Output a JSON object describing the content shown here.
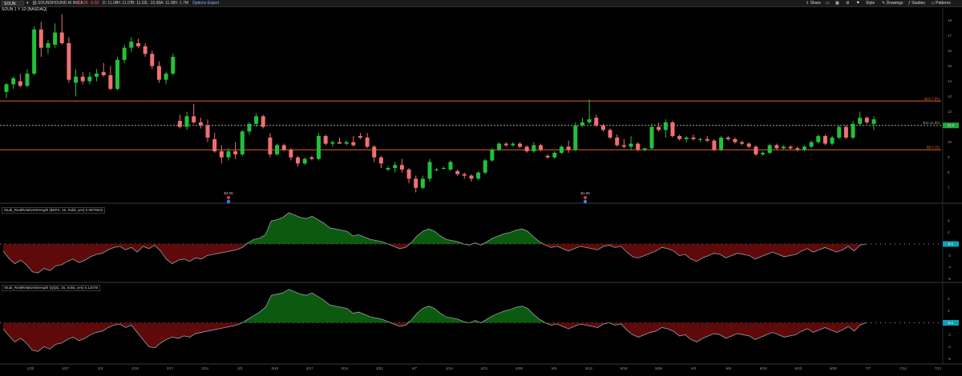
{
  "topbar": {
    "symbol": "SOUN",
    "quote": "SOUNDHOUND AI INC A",
    "price": "$1.28",
    "change": "-0.02",
    "stats": [
      "D: 11.06",
      "H: 11.07",
      "B: 11.02",
      "L: 10.98",
      "A: 11.08",
      "V: 1.7M"
    ],
    "link": "Options Expert",
    "buttons": [
      "Share",
      "Style",
      "Drawings",
      "Studies",
      "Patterns"
    ]
  },
  "chart_header": "SOUN 1 Y 1D [NASDAQ]",
  "price_levels": {
    "upper": {
      "label": "$12.7 (R)",
      "color": "#e0602b"
    },
    "current": {
      "label": "$11.11 (D)",
      "color": "#cccccc"
    },
    "lower": {
      "label": "$9.5 (S)",
      "color": "#e0602b"
    },
    "last_badge": "11.1"
  },
  "event_markers": [
    {
      "label": "$3.25",
      "x_date": "2/28"
    },
    {
      "label": "$1.09",
      "x_date": "5/8"
    }
  ],
  "study1_label": "Studi_RealRelativeStrength ($SPX, 15, Solid, yes)  0.0979523",
  "study2_label": "Studi_RealRelativeStrength (QQQ, 15, Solid, yes)  0.12078",
  "study_badge": "0.1",
  "colors": {
    "up": "#23c03a",
    "down": "#f07070",
    "pos_fill": "#0c5a10",
    "neg_fill": "#5e0a0a",
    "level": "#e0602b"
  },
  "chart_data": {
    "type": "candlestick",
    "price_axis": {
      "ylim": [
        6.2,
        18.6
      ],
      "ticks": [
        7,
        8,
        9,
        10,
        11,
        12,
        13,
        14,
        15,
        16,
        17,
        18
      ]
    },
    "x_ticks": [
      "1/20",
      "1/27",
      "2/3",
      "2/10",
      "2/17",
      "2/24",
      "3/3",
      "3/10",
      "3/17",
      "3/24",
      "3/31",
      "4/7",
      "4/14",
      "4/21",
      "4/28",
      "5/5",
      "5/12",
      "5/19",
      "5/26",
      "6/2",
      "6/9",
      "6/16",
      "6/23",
      "6/30",
      "7/7",
      "7/14",
      "7/21"
    ],
    "candles": [
      [
        13.3,
        13.9,
        12.9,
        13.8
      ],
      [
        13.8,
        14.3,
        13.5,
        14.2
      ],
      [
        14.0,
        14.5,
        13.6,
        13.7
      ],
      [
        13.7,
        14.8,
        13.6,
        14.5
      ],
      [
        14.5,
        17.6,
        14.4,
        17.4
      ],
      [
        17.4,
        17.9,
        15.6,
        16.2
      ],
      [
        16.2,
        16.7,
        15.8,
        16.5
      ],
      [
        16.4,
        17.8,
        16.2,
        17.2
      ],
      [
        17.2,
        18.4,
        16.4,
        16.5
      ],
      [
        16.5,
        16.9,
        13.9,
        14.1
      ],
      [
        13.9,
        14.8,
        13.0,
        14.3
      ],
      [
        14.3,
        14.6,
        13.8,
        14.0
      ],
      [
        14.0,
        14.6,
        13.8,
        14.3
      ],
      [
        14.3,
        14.8,
        14.0,
        14.5
      ],
      [
        14.6,
        15.2,
        14.3,
        14.4
      ],
      [
        14.4,
        15.0,
        13.4,
        13.5
      ],
      [
        13.5,
        15.6,
        13.4,
        15.4
      ],
      [
        15.4,
        16.4,
        15.2,
        16.2
      ],
      [
        16.2,
        16.9,
        15.9,
        16.6
      ],
      [
        16.5,
        16.8,
        16.2,
        16.3
      ],
      [
        16.3,
        16.5,
        15.6,
        15.8
      ],
      [
        15.8,
        16.0,
        14.8,
        15.0
      ],
      [
        15.0,
        15.3,
        13.9,
        14.1
      ],
      [
        14.1,
        14.6,
        13.8,
        14.5
      ],
      [
        14.5,
        15.8,
        14.4,
        15.6
      ],
      [
        11.4,
        11.8,
        10.9,
        11.0
      ],
      [
        11.0,
        12.0,
        10.8,
        11.7
      ],
      [
        11.7,
        12.5,
        11.2,
        11.3
      ],
      [
        11.3,
        11.6,
        10.9,
        11.1
      ],
      [
        11.1,
        11.5,
        10.0,
        10.3
      ],
      [
        10.2,
        10.6,
        9.3,
        9.4
      ],
      [
        9.4,
        9.8,
        8.6,
        9.0
      ],
      [
        9.0,
        9.6,
        8.8,
        9.4
      ],
      [
        9.4,
        10.0,
        8.9,
        9.2
      ],
      [
        9.2,
        10.8,
        9.1,
        10.7
      ],
      [
        10.7,
        11.3,
        10.5,
        11.2
      ],
      [
        11.2,
        11.9,
        11.0,
        11.7
      ],
      [
        11.7,
        11.8,
        10.9,
        11.0
      ],
      [
        10.3,
        10.6,
        9.0,
        9.2
      ],
      [
        9.2,
        9.9,
        9.1,
        9.8
      ],
      [
        9.8,
        9.9,
        9.4,
        9.5
      ],
      [
        9.5,
        9.6,
        8.8,
        9.0
      ],
      [
        9.0,
        9.1,
        8.4,
        8.6
      ],
      [
        8.6,
        9.0,
        8.5,
        8.9
      ],
      [
        9.0,
        9.1,
        8.8,
        8.9
      ],
      [
        8.9,
        10.6,
        8.8,
        10.4
      ],
      [
        10.4,
        10.5,
        9.8,
        9.9
      ],
      [
        9.9,
        10.1,
        9.7,
        10.0
      ],
      [
        10.0,
        10.3,
        9.9,
        9.9
      ],
      [
        9.9,
        10.1,
        9.8,
        10.0
      ],
      [
        10.0,
        10.4,
        9.7,
        9.8
      ],
      [
        10.4,
        10.6,
        10.2,
        10.3
      ],
      [
        10.3,
        10.6,
        9.6,
        9.7
      ],
      [
        9.7,
        9.8,
        8.7,
        9.0
      ],
      [
        9.0,
        9.1,
        8.3,
        8.6
      ],
      [
        8.2,
        8.4,
        8.1,
        8.3
      ],
      [
        8.3,
        8.7,
        8.0,
        8.5
      ],
      [
        8.5,
        8.9,
        8.0,
        8.2
      ],
      [
        8.2,
        8.3,
        7.3,
        7.6
      ],
      [
        7.6,
        7.8,
        6.7,
        7.0
      ],
      [
        7.0,
        7.8,
        6.9,
        7.6
      ],
      [
        7.6,
        8.9,
        7.4,
        8.7
      ],
      [
        8.2,
        8.3,
        8.1,
        8.2
      ],
      [
        8.3,
        8.4,
        8.2,
        8.3
      ],
      [
        8.2,
        8.8,
        8.1,
        8.7
      ],
      [
        8.1,
        8.2,
        7.8,
        7.9
      ],
      [
        7.9,
        8.0,
        7.6,
        7.8
      ],
      [
        7.8,
        7.9,
        7.4,
        7.6
      ],
      [
        7.6,
        8.1,
        7.5,
        8.0
      ],
      [
        8.0,
        8.9,
        7.9,
        8.8
      ],
      [
        8.8,
        9.6,
        8.7,
        9.5
      ],
      [
        9.5,
        10.0,
        9.4,
        9.9
      ],
      [
        9.9,
        10.0,
        9.7,
        9.8
      ],
      [
        9.8,
        10.0,
        9.7,
        9.9
      ],
      [
        9.9,
        10.0,
        9.6,
        9.7
      ],
      [
        9.7,
        9.8,
        9.3,
        9.4
      ],
      [
        9.4,
        10.0,
        9.3,
        9.8
      ],
      [
        9.8,
        9.9,
        9.4,
        9.5
      ],
      [
        9.1,
        9.2,
        8.9,
        9.0
      ],
      [
        9.0,
        9.4,
        8.9,
        9.3
      ],
      [
        9.3,
        9.8,
        9.2,
        9.7
      ],
      [
        9.7,
        10.1,
        9.3,
        9.5
      ],
      [
        9.5,
        11.3,
        9.4,
        11.1
      ],
      [
        11.1,
        11.6,
        11.0,
        11.3
      ],
      [
        11.3,
        12.8,
        11.2,
        11.5
      ],
      [
        11.6,
        11.8,
        11.0,
        11.1
      ],
      [
        11.1,
        11.2,
        10.7,
        10.8
      ],
      [
        10.8,
        10.9,
        10.2,
        10.3
      ],
      [
        10.3,
        10.5,
        9.7,
        9.8
      ],
      [
        9.8,
        10.2,
        9.6,
        9.7
      ],
      [
        9.7,
        10.4,
        9.5,
        9.9
      ],
      [
        9.9,
        10.0,
        9.4,
        9.5
      ],
      [
        9.5,
        9.6,
        9.4,
        9.6
      ],
      [
        9.6,
        11.2,
        9.5,
        11.0
      ],
      [
        11.0,
        11.3,
        10.7,
        10.8
      ],
      [
        10.8,
        11.5,
        10.3,
        11.3
      ],
      [
        11.3,
        11.4,
        10.3,
        10.4
      ],
      [
        10.4,
        10.5,
        10.1,
        10.2
      ],
      [
        10.2,
        10.4,
        10.0,
        10.3
      ],
      [
        10.3,
        10.5,
        10.1,
        10.2
      ],
      [
        10.2,
        10.3,
        10.0,
        10.2
      ],
      [
        10.2,
        10.4,
        10.0,
        10.1
      ],
      [
        10.1,
        10.2,
        9.4,
        9.5
      ],
      [
        9.5,
        10.4,
        9.4,
        10.3
      ],
      [
        10.3,
        10.4,
        10.1,
        10.2
      ],
      [
        10.2,
        10.3,
        9.9,
        10.0
      ],
      [
        10.0,
        10.1,
        9.8,
        9.9
      ],
      [
        9.9,
        10.0,
        9.6,
        9.7
      ],
      [
        9.7,
        9.8,
        9.1,
        9.2
      ],
      [
        9.2,
        9.4,
        9.1,
        9.3
      ],
      [
        9.3,
        9.9,
        9.2,
        9.8
      ],
      [
        9.8,
        9.9,
        9.5,
        9.6
      ],
      [
        9.6,
        9.8,
        9.5,
        9.7
      ],
      [
        9.7,
        9.8,
        9.5,
        9.6
      ],
      [
        9.6,
        9.7,
        9.4,
        9.5
      ],
      [
        9.5,
        9.8,
        9.4,
        9.7
      ],
      [
        9.7,
        10.1,
        9.6,
        10.0
      ],
      [
        10.0,
        10.5,
        9.9,
        10.4
      ],
      [
        10.4,
        10.5,
        9.8,
        9.9
      ],
      [
        9.9,
        10.4,
        9.8,
        10.3
      ],
      [
        10.3,
        11.1,
        10.2,
        11.0
      ],
      [
        11.0,
        11.1,
        10.2,
        10.3
      ],
      [
        10.3,
        11.4,
        10.2,
        11.2
      ],
      [
        11.2,
        12.0,
        11.1,
        11.6
      ],
      [
        11.6,
        11.7,
        11.2,
        11.3
      ],
      [
        11.2,
        11.7,
        10.8,
        11.5
      ]
    ],
    "study_axis": {
      "ylim": [
        -6.5,
        6.5
      ],
      "ticks": [
        4,
        2,
        0,
        -2,
        -4,
        -6
      ]
    },
    "rrs_spx": [
      -1.2,
      -2.5,
      -3.4,
      -2.8,
      -3.6,
      -4.8,
      -5.0,
      -4.2,
      -4.6,
      -3.8,
      -3.6,
      -3.0,
      -2.6,
      -3.2,
      -2.8,
      -2.2,
      -1.8,
      -1.6,
      -1.0,
      -0.6,
      -0.4,
      -1.0,
      -0.6,
      -1.4,
      -0.4,
      -0.8,
      -0.2,
      -1.2,
      -2.6,
      -3.4,
      -2.8,
      -2.6,
      -3.0,
      -2.4,
      -2.6,
      -2.0,
      -1.8,
      -1.6,
      -1.4,
      -1.2,
      -1.0,
      -0.6,
      0.2,
      0.8,
      1.0,
      1.6,
      4.0,
      4.2,
      4.6,
      5.4,
      5.0,
      4.6,
      4.4,
      4.8,
      4.2,
      3.6,
      2.8,
      2.6,
      2.4,
      2.2,
      1.4,
      1.6,
      1.2,
      0.8,
      0.6,
      0.4,
      0.0,
      -0.4,
      -0.8,
      -0.6,
      0.2,
      1.4,
      2.2,
      2.6,
      2.2,
      1.4,
      0.8,
      0.6,
      0.4,
      0.0,
      -0.2,
      0.2,
      -0.2,
      0.4,
      1.0,
      1.4,
      1.8,
      2.0,
      2.4,
      2.6,
      2.2,
      1.2,
      0.4,
      -0.2,
      -0.6,
      -0.4,
      -0.8,
      -1.2,
      -0.8,
      -0.4,
      -0.6,
      -0.8,
      -1.0,
      -0.4,
      -0.2,
      -0.6,
      -0.4,
      -1.4,
      -2.2,
      -2.4,
      -2.0,
      -1.6,
      -1.2,
      -0.6,
      -0.8,
      -1.2,
      -2.0,
      -1.8,
      -2.6,
      -3.0,
      -2.4,
      -2.0,
      -1.6,
      -1.8,
      -2.4,
      -2.0,
      -1.6,
      -1.8,
      -2.0,
      -2.6,
      -2.2,
      -1.8,
      -1.4,
      -1.8,
      -2.2,
      -2.0,
      -1.8,
      -1.2,
      -0.8,
      -1.4,
      -1.0,
      -0.6,
      -1.0,
      -1.4,
      -1.0,
      -0.4,
      -1.2,
      -0.2,
      0.0
    ],
    "rrs_qqq": [
      -1.0,
      -2.2,
      -3.2,
      -2.6,
      -3.4,
      -4.6,
      -4.8,
      -4.0,
      -4.4,
      -3.6,
      -3.4,
      -2.8,
      -2.4,
      -3.0,
      -2.6,
      -2.0,
      -1.6,
      -1.4,
      -0.8,
      -0.4,
      -0.2,
      -0.8,
      -0.4,
      -1.6,
      -2.8,
      -4.0,
      -4.2,
      -3.4,
      -2.8,
      -2.4,
      -2.6,
      -2.2,
      -2.4,
      -1.8,
      -1.6,
      -1.4,
      -1.2,
      -1.0,
      -0.8,
      -0.6,
      -0.4,
      0.0,
      0.6,
      1.2,
      1.8,
      2.6,
      4.6,
      4.8,
      5.0,
      5.6,
      5.2,
      4.8,
      4.6,
      5.0,
      4.4,
      3.8,
      3.0,
      2.8,
      2.6,
      2.4,
      1.6,
      1.8,
      1.4,
      1.0,
      0.8,
      0.6,
      0.2,
      -0.2,
      -0.6,
      -0.4,
      0.4,
      1.6,
      2.4,
      2.8,
      2.4,
      1.6,
      1.0,
      0.8,
      0.6,
      0.2,
      0.0,
      0.4,
      0.0,
      0.6,
      1.2,
      1.6,
      2.0,
      2.2,
      2.6,
      2.8,
      2.4,
      1.4,
      0.6,
      0.0,
      -0.4,
      -0.2,
      -0.6,
      -1.0,
      -0.6,
      -0.2,
      -0.4,
      -0.6,
      -0.8,
      -0.2,
      0.0,
      -0.4,
      -0.2,
      -1.2,
      -2.0,
      -2.4,
      -2.0,
      -1.6,
      -1.4,
      -0.8,
      -1.0,
      -1.4,
      -2.2,
      -2.0,
      -2.8,
      -3.2,
      -2.6,
      -2.2,
      -1.8,
      -2.0,
      -2.6,
      -2.2,
      -1.8,
      -2.0,
      -2.2,
      -2.8,
      -2.4,
      -2.0,
      -1.6,
      -2.0,
      -2.4,
      -2.2,
      -2.0,
      -1.4,
      -1.0,
      -1.6,
      -1.2,
      -0.8,
      -1.2,
      -1.6,
      -1.2,
      -0.6,
      -1.4,
      -0.4,
      0.0
    ]
  }
}
